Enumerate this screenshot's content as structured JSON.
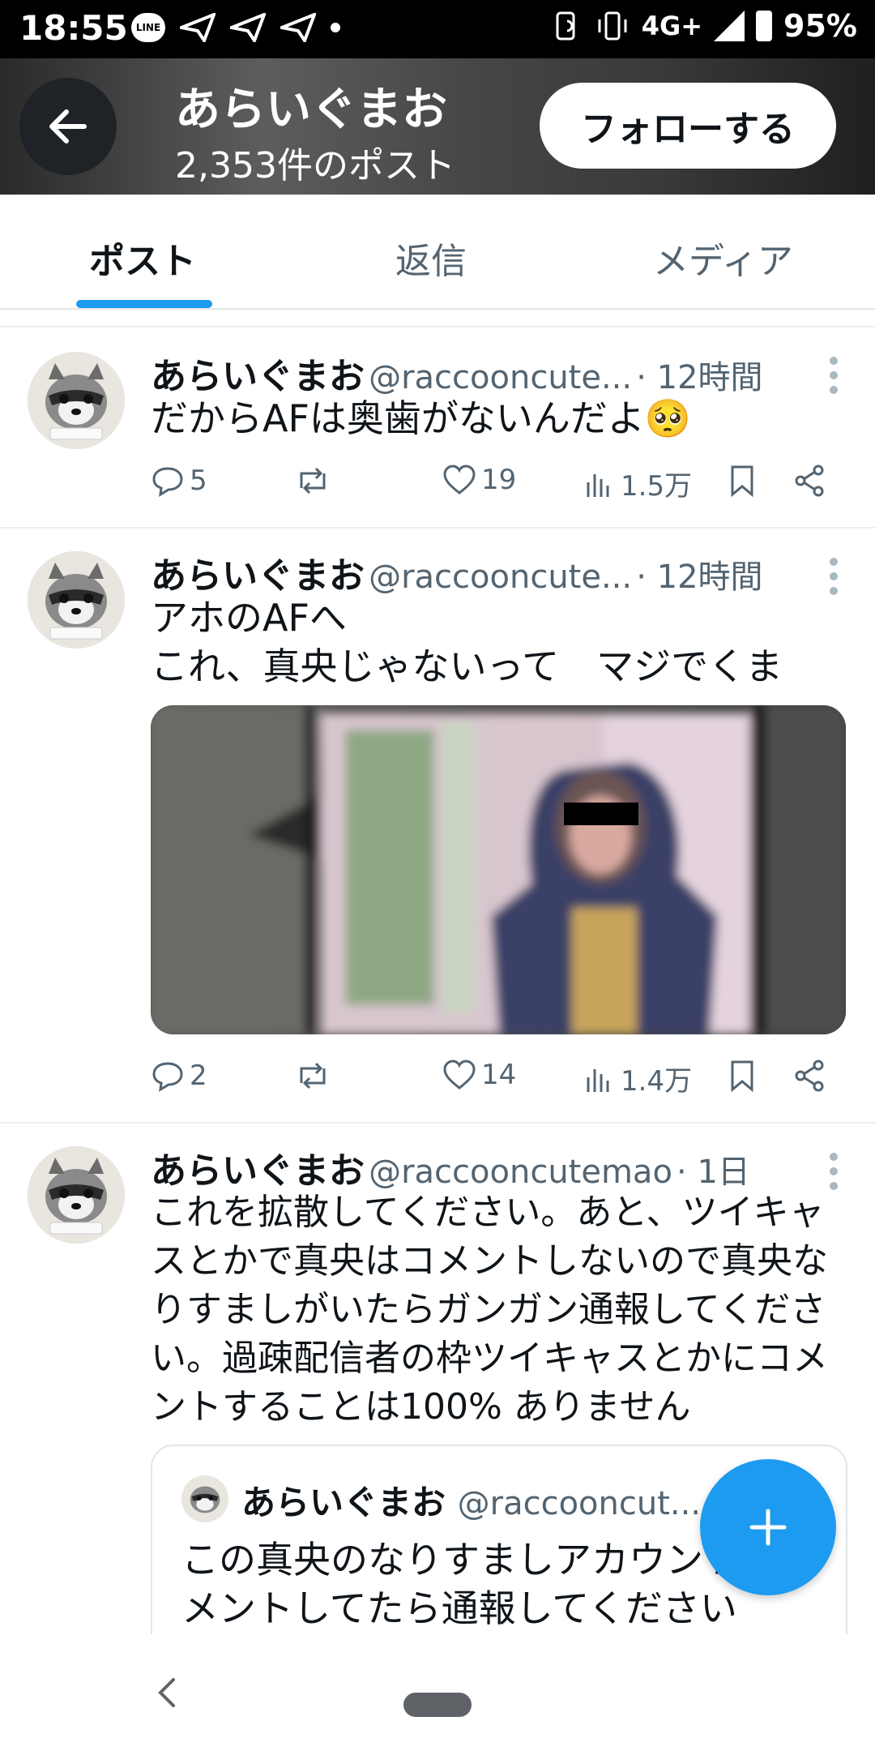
{
  "status_bar": {
    "time": "18:55",
    "line_label": "LINE",
    "network": "4G+",
    "battery": "95%"
  },
  "header": {
    "name": "あらいぐまお",
    "post_count": "2,353件のポスト",
    "follow_label": "フォローする"
  },
  "tabs": [
    {
      "label": "ポスト",
      "active": true
    },
    {
      "label": "返信",
      "active": false
    },
    {
      "label": "メディア",
      "active": false
    }
  ],
  "tweets": [
    {
      "name": "あらいぐまお",
      "handle": "@raccooncute...",
      "time": "· 12時間",
      "text": "だからAFは奥歯がないんだよ🥺",
      "replies": "5",
      "likes": "19",
      "views": "1.5万"
    },
    {
      "name": "あらいぐまお",
      "handle": "@raccooncute...",
      "time": "· 12時間",
      "text": "アホのAFへ\nこれ、真央じゃないって　マジでくま",
      "replies": "2",
      "likes": "14",
      "views": "1.4万"
    },
    {
      "name": "あらいぐまお",
      "handle": "@raccooncutemao",
      "time": "· 1日",
      "text": "これを拡散してください。あと、ツイキャ\nスとかで真央はコメントしないので真央な\nりすましがいたらガンガン通報してくださ\nい。過疎配信者の枠ツイキャスとかにコメ\nントすることは100% ありません",
      "quote": {
        "name": "あらいぐまお",
        "handle": "@raccooncut...",
        "text": "この真央のなりすましアカウント\nメントしてたら通報してください"
      }
    }
  ],
  "colors": {
    "accent": "#1d9bf0",
    "text": "#0f1419",
    "secondary": "#536471"
  }
}
